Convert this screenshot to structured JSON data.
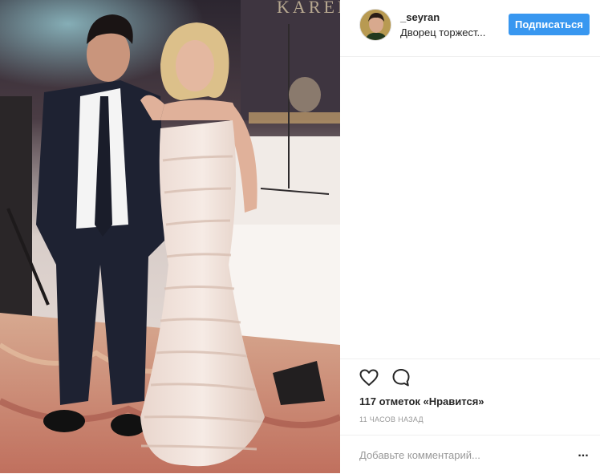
{
  "header": {
    "username": "_seyran",
    "location": "Дворец торжест...",
    "follow_label": "Подписаться"
  },
  "photo": {
    "banner_text": "KAREN"
  },
  "actions": {
    "like_icon": "heart-outline-icon",
    "comment_icon": "speech-bubble-icon"
  },
  "likes_text": "117 отметок «Нравится»",
  "timestamp": "11 ЧАСОВ НАЗАД",
  "comment": {
    "placeholder": "Добавьте комментарий...",
    "more_label": "..."
  },
  "colors": {
    "accent": "#3897f0",
    "text": "#262626",
    "muted": "#999999"
  }
}
